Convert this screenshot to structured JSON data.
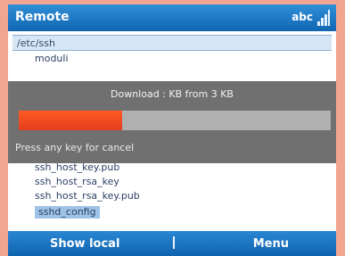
{
  "app": {
    "title": "Remote",
    "input_mode": "abc"
  },
  "path_bar": {
    "path": "/etc/ssh"
  },
  "file_list": {
    "items": [
      {
        "name": "moduli",
        "selected": false
      },
      {
        "name": "ssh_host_key.pub",
        "selected": false
      },
      {
        "name": "ssh_host_rsa_key",
        "selected": false
      },
      {
        "name": "ssh_host_rsa_key.pub",
        "selected": false
      },
      {
        "name": "sshd_config",
        "selected": true
      }
    ]
  },
  "download_dialog": {
    "status": "Download : KB from 3 KB",
    "progress": 0.33,
    "hint": "Press any key for cancel"
  },
  "softkeys": {
    "left": "Show local",
    "right": "Menu"
  }
}
